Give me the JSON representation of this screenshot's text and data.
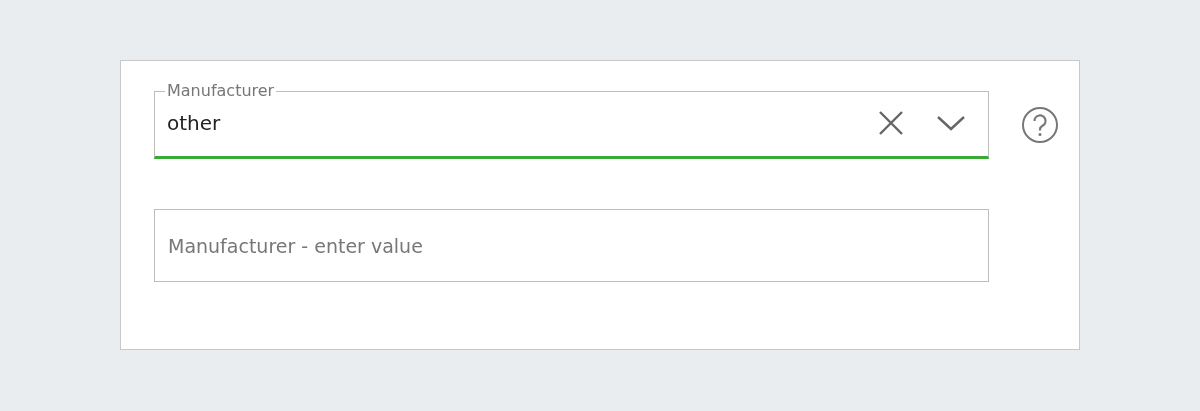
{
  "manufacturer_select": {
    "label": "Manufacturer",
    "value": "other",
    "valid": true
  },
  "manufacturer_input": {
    "placeholder": "Manufacturer - enter value"
  }
}
